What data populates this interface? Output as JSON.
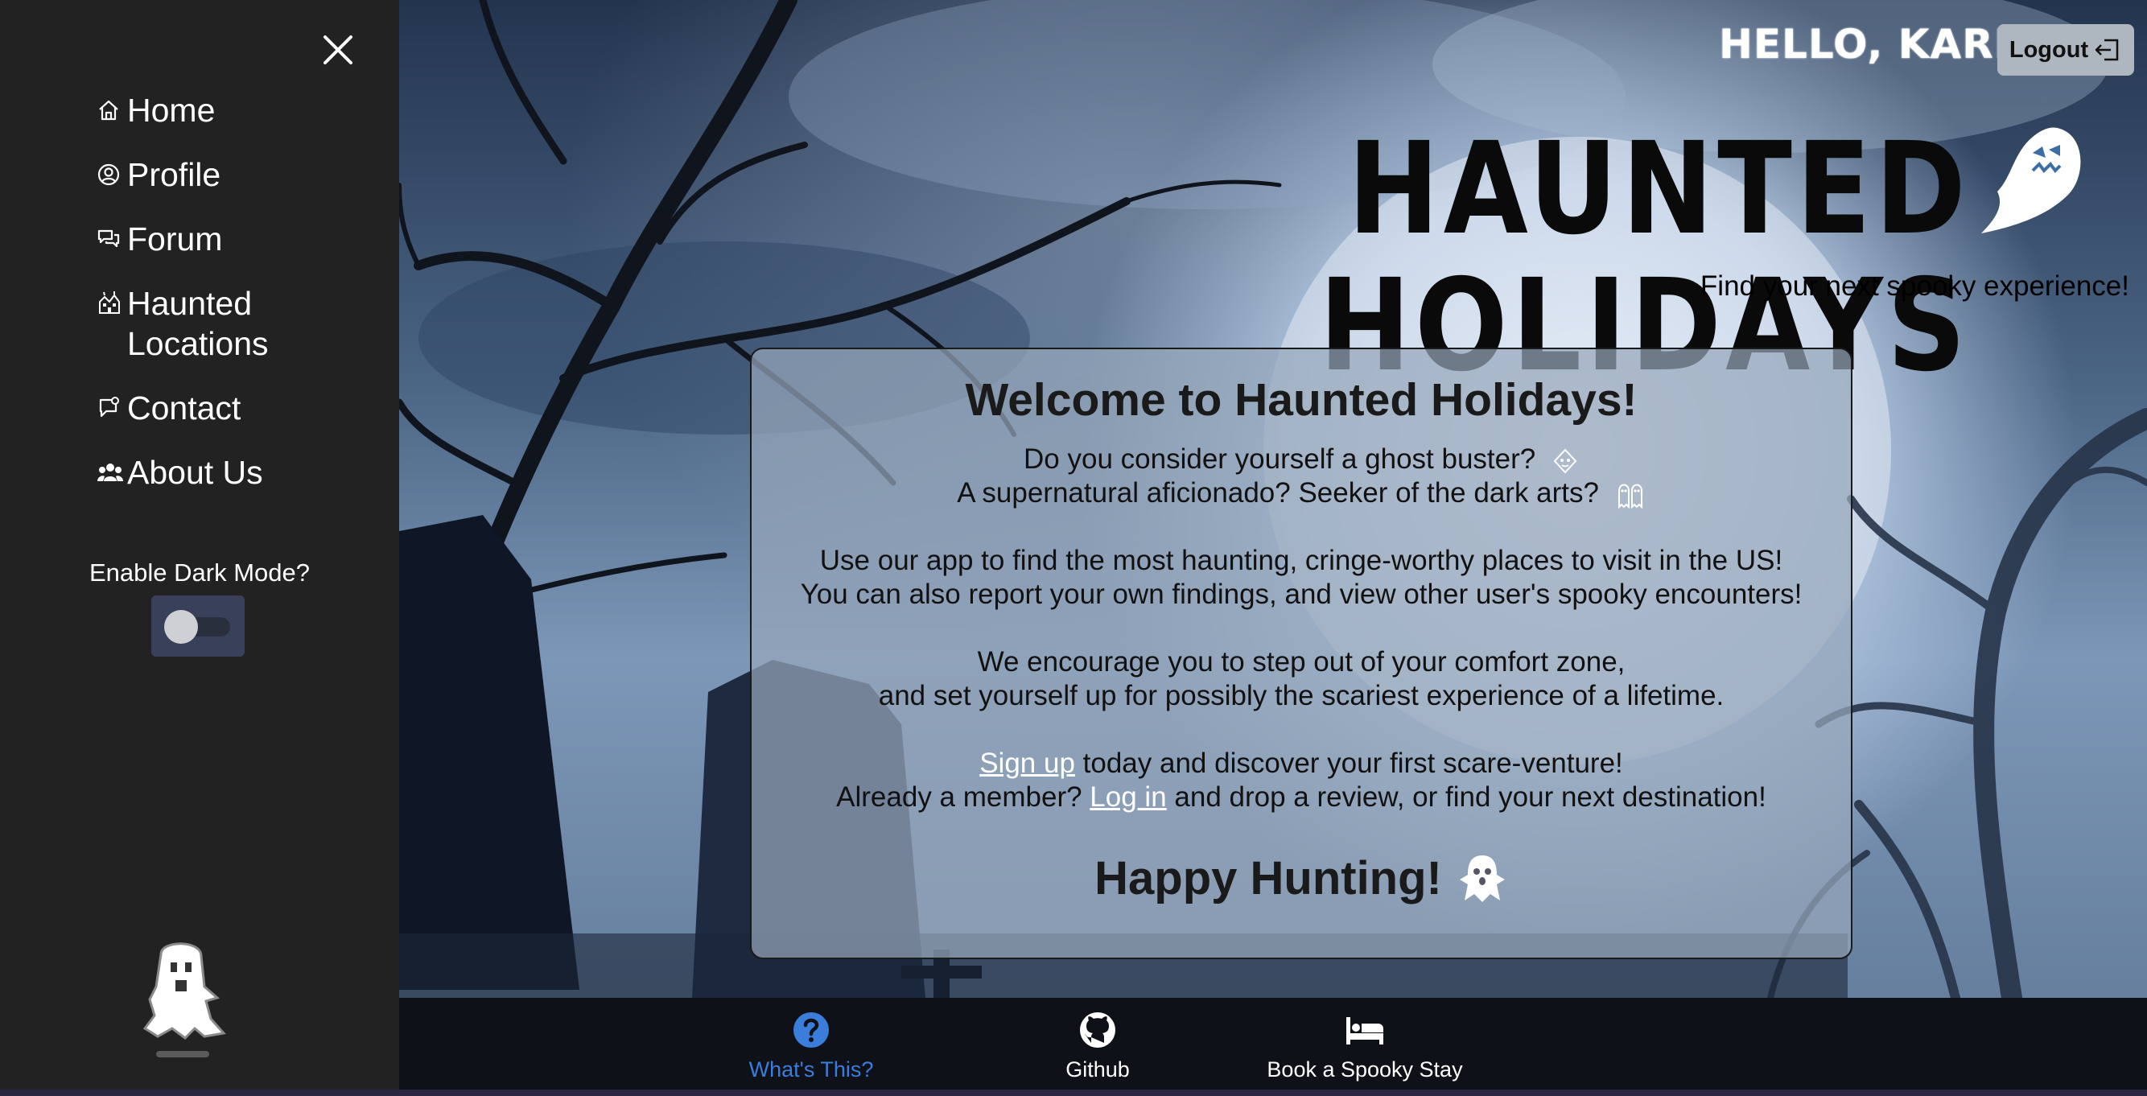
{
  "header": {
    "greeting": "HELLO, KARINA!",
    "logout_label": "Logout",
    "app_title": "HAUNTED HOLIDAYS",
    "tagline": "Find your next spooky experience!"
  },
  "sidebar": {
    "items": [
      {
        "label": "Home",
        "icon": "home-icon"
      },
      {
        "label": "Profile",
        "icon": "user-circle-icon"
      },
      {
        "label": "Forum",
        "icon": "chat-icon"
      },
      {
        "label": "Haunted\nLocations",
        "icon": "haunted-house-icon"
      },
      {
        "label": "Contact",
        "icon": "message-icon"
      },
      {
        "label": "About Us",
        "icon": "people-icon"
      }
    ],
    "dark_mode_label": "Enable Dark Mode?",
    "dark_mode_on": false
  },
  "welcome": {
    "title": "Welcome to Haunted Holidays!",
    "line1": "Do you consider yourself a ghost buster?",
    "line2": "A supernatural aficionado? Seeker of the dark arts?",
    "line3": "Use our app to find the most haunting, cringe-worthy places to visit in the US!",
    "line4": "You can also report your own findings, and view other user's spooky encounters!",
    "line5": "We encourage you to step out of your comfort zone,",
    "line6": "and set yourself up for possibly the scariest experience of a lifetime.",
    "signup_link": "Sign up",
    "signup_rest": " today and discover your first scare-venture!",
    "login_prefix": "Already a member? ",
    "login_link": "Log in",
    "login_rest": " and drop a review, or find your next destination!",
    "closing": "Happy Hunting!"
  },
  "footer": {
    "items": [
      {
        "label": "What's This?",
        "icon": "question-circle-icon",
        "active": true
      },
      {
        "label": "Github",
        "icon": "github-icon",
        "active": false
      },
      {
        "label": "Book a Spooky Stay",
        "icon": "bed-icon",
        "active": false
      }
    ]
  },
  "colors": {
    "sidebar_bg": "#222222",
    "footer_bg": "#0e1118",
    "active_accent": "#3b7ddb",
    "card_bg": "rgba(150,166,186,0.72)"
  }
}
